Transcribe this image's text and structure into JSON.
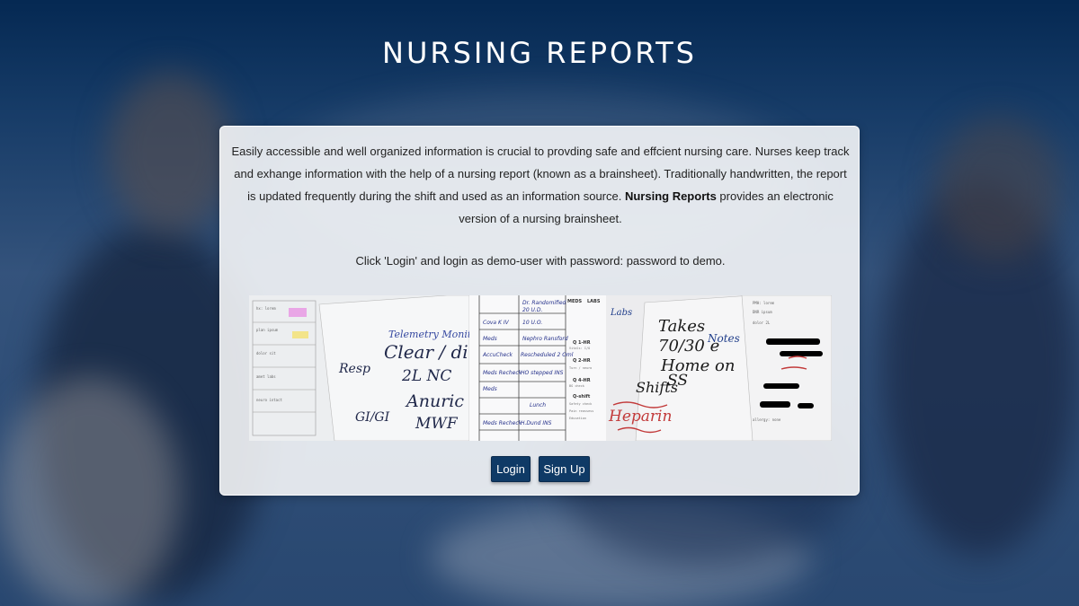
{
  "page": {
    "title": "NURSING REPORTS"
  },
  "intro": {
    "part1": "Easily accessible and well organized information is crucial to provding safe and effcient nursing care. Nurses keep track and exhange information with the help of a nursing report (known as a brainsheet). Traditionally handwritten, the report is updated frequently during the shift and used as an information source. ",
    "bold": "Nursing Reports",
    "part2": " provides an electronic version of a nursing brainsheet."
  },
  "hint": "Click 'Login' and login as demo-user with password: password to demo.",
  "collage": {
    "panel1": {
      "telemetry": "Telemetry Monitor #",
      "line1": "Clear / dimi",
      "resp": "Resp",
      "nc": "2L NC",
      "anuric": "Anuric",
      "gi": "GI/GI",
      "mwf": "MWF"
    },
    "panel2": {
      "meds": "MEDS",
      "labs": "LABS",
      "row1": "Dr. Randomified",
      "row1b": "20 U.D.",
      "row2": "Cova K IV",
      "row2b": "10 U.O.",
      "row3": "Meds",
      "row3b": "Nephro Ransford",
      "row4": "AccuCheck",
      "row4b": "Rescheduled 2 Oml",
      "row5": "Meds Recheck",
      "row5b": "HO stepped INS",
      "row6": "Meds",
      "row7": "Lunch",
      "row8": "Meds Recheck",
      "row8b": "H.Dund INS",
      "q1": "Q 1-HR",
      "q2": "Q 2-HR",
      "q4": "Q 4-HR",
      "q6": "Q-shift"
    },
    "panel3": {
      "labs": "Labs",
      "notes": "Notes",
      "takes": "Takes",
      "ratio": "70/30 e",
      "home": "Home on",
      "ss": "SS",
      "shifts": "Shifts",
      "heparin": "Heparin"
    }
  },
  "buttons": {
    "login": "Login",
    "signup": "Sign Up"
  }
}
